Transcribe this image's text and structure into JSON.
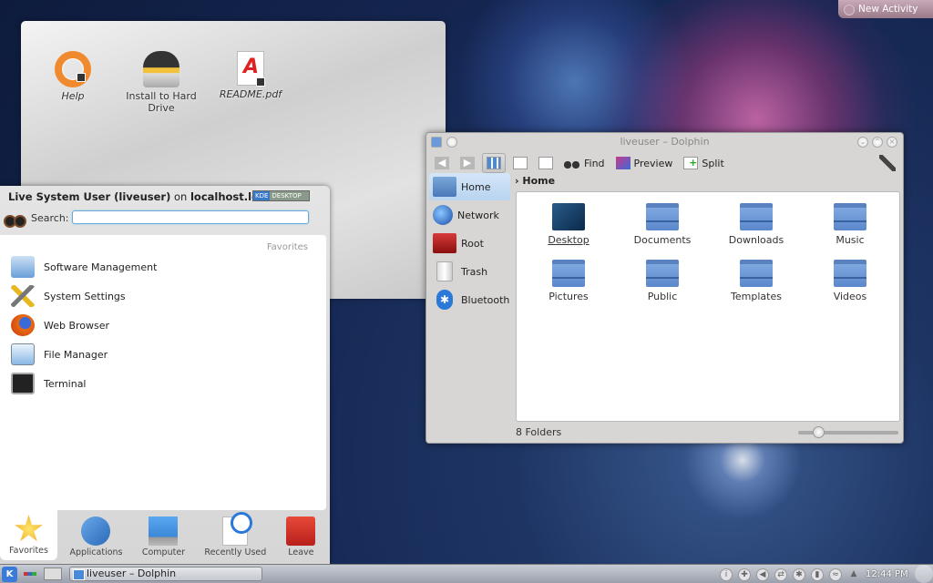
{
  "desktop": {
    "new_activity": "New Activity",
    "icons": [
      {
        "label": "Help",
        "icon": "lifebuoy-icon"
      },
      {
        "label": "Install to Hard Drive",
        "icon": "tux-install-icon"
      },
      {
        "label": "README.pdf",
        "icon": "pdf-icon"
      }
    ]
  },
  "kickoff": {
    "user_name": "Live System User (liveuser)",
    "on": "on",
    "host": "localhost.loca",
    "badge_left": "KDE",
    "badge_right": "DESKTOP",
    "search_label": "Search:",
    "search_value": "",
    "favorites_header": "Favorites",
    "favorites": [
      {
        "label": "Software Management",
        "icon": "software-management-icon"
      },
      {
        "label": "System Settings",
        "icon": "system-settings-icon"
      },
      {
        "label": "Web Browser",
        "icon": "firefox-icon"
      },
      {
        "label": "File Manager",
        "icon": "file-manager-icon"
      },
      {
        "label": "Terminal",
        "icon": "terminal-icon"
      }
    ],
    "tabs": [
      {
        "label": "Favorites",
        "selected": true
      },
      {
        "label": "Applications",
        "selected": false
      },
      {
        "label": "Computer",
        "selected": false
      },
      {
        "label": "Recently Used",
        "selected": false
      },
      {
        "label": "Leave",
        "selected": false
      }
    ]
  },
  "dolphin": {
    "title": "liveuser – Dolphin",
    "toolbar": {
      "find": "Find",
      "preview": "Preview",
      "split": "Split"
    },
    "places": [
      {
        "label": "Home",
        "selected": true
      },
      {
        "label": "Network",
        "selected": false
      },
      {
        "label": "Root",
        "selected": false
      },
      {
        "label": "Trash",
        "selected": false
      },
      {
        "label": "Bluetooth",
        "selected": false
      }
    ],
    "breadcrumb": "Home",
    "files": [
      "Desktop",
      "Documents",
      "Downloads",
      "Music",
      "Pictures",
      "Public",
      "Templates",
      "Videos"
    ],
    "status": "8 Folders",
    "zoom_level_fraction": 0.2
  },
  "taskbar": {
    "task": "liveuser – Dolphin",
    "clock": "12:44 PM"
  }
}
